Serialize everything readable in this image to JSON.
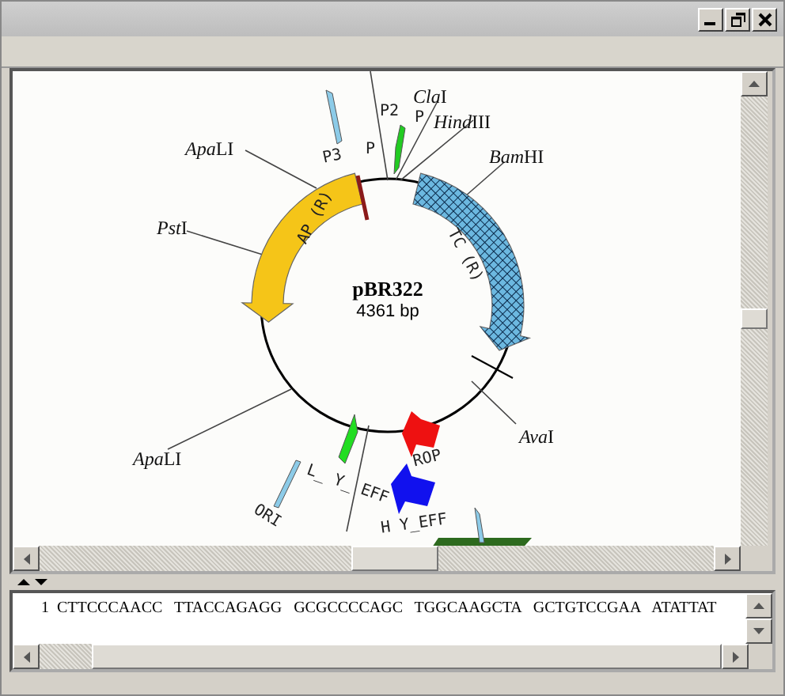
{
  "map": {
    "title": "pBR322",
    "length": "4361 bp",
    "sites": [
      {
        "italic": "Apa",
        "label": "LI"
      },
      {
        "italic": "Pst",
        "label": "I"
      },
      {
        "italic": "Cla",
        "label": "I"
      },
      {
        "italic": "Hind",
        "label": "III"
      },
      {
        "italic": "Bam",
        "label": "HI"
      },
      {
        "italic": "Ava",
        "label": "I"
      },
      {
        "italic": "Apa",
        "label": "LI"
      }
    ],
    "features": [
      {
        "kind": "band",
        "label": "AP (R)",
        "color": "#f5c518"
      },
      {
        "kind": "hatched-band",
        "label": "TC (R)",
        "color": "#6cb8e0"
      },
      {
        "kind": "tick",
        "label": "P3",
        "tag": "P",
        "color": "#8b1a1a"
      },
      {
        "kind": "thin-arrow",
        "label": "P2",
        "tag": "P",
        "color": "#22cc22"
      },
      {
        "kind": "thin-arrow",
        "color": "#8ccbe8"
      },
      {
        "kind": "block-arrow",
        "label": "ROP",
        "color": "#ee1111"
      },
      {
        "kind": "thin-arrow",
        "label": "L_ Y_ EFF",
        "color": "#22dd22"
      },
      {
        "kind": "block-arrow",
        "label": "H Y_EFF",
        "color": "#1111ee"
      },
      {
        "kind": "thin-arrow",
        "label": "ORI",
        "color": "#8ccbe8"
      },
      {
        "kind": "block-arrow",
        "color": "#2d6a1e"
      },
      {
        "kind": "thin-arrow",
        "color": "#8ccbe8"
      }
    ]
  },
  "sequence": {
    "line_number": "1",
    "text": "CTTCCCAACC TTACCAGAGG GCGCCCCAGC TGGCAAGCTA GCTGTCCGAA ATATTAT"
  }
}
